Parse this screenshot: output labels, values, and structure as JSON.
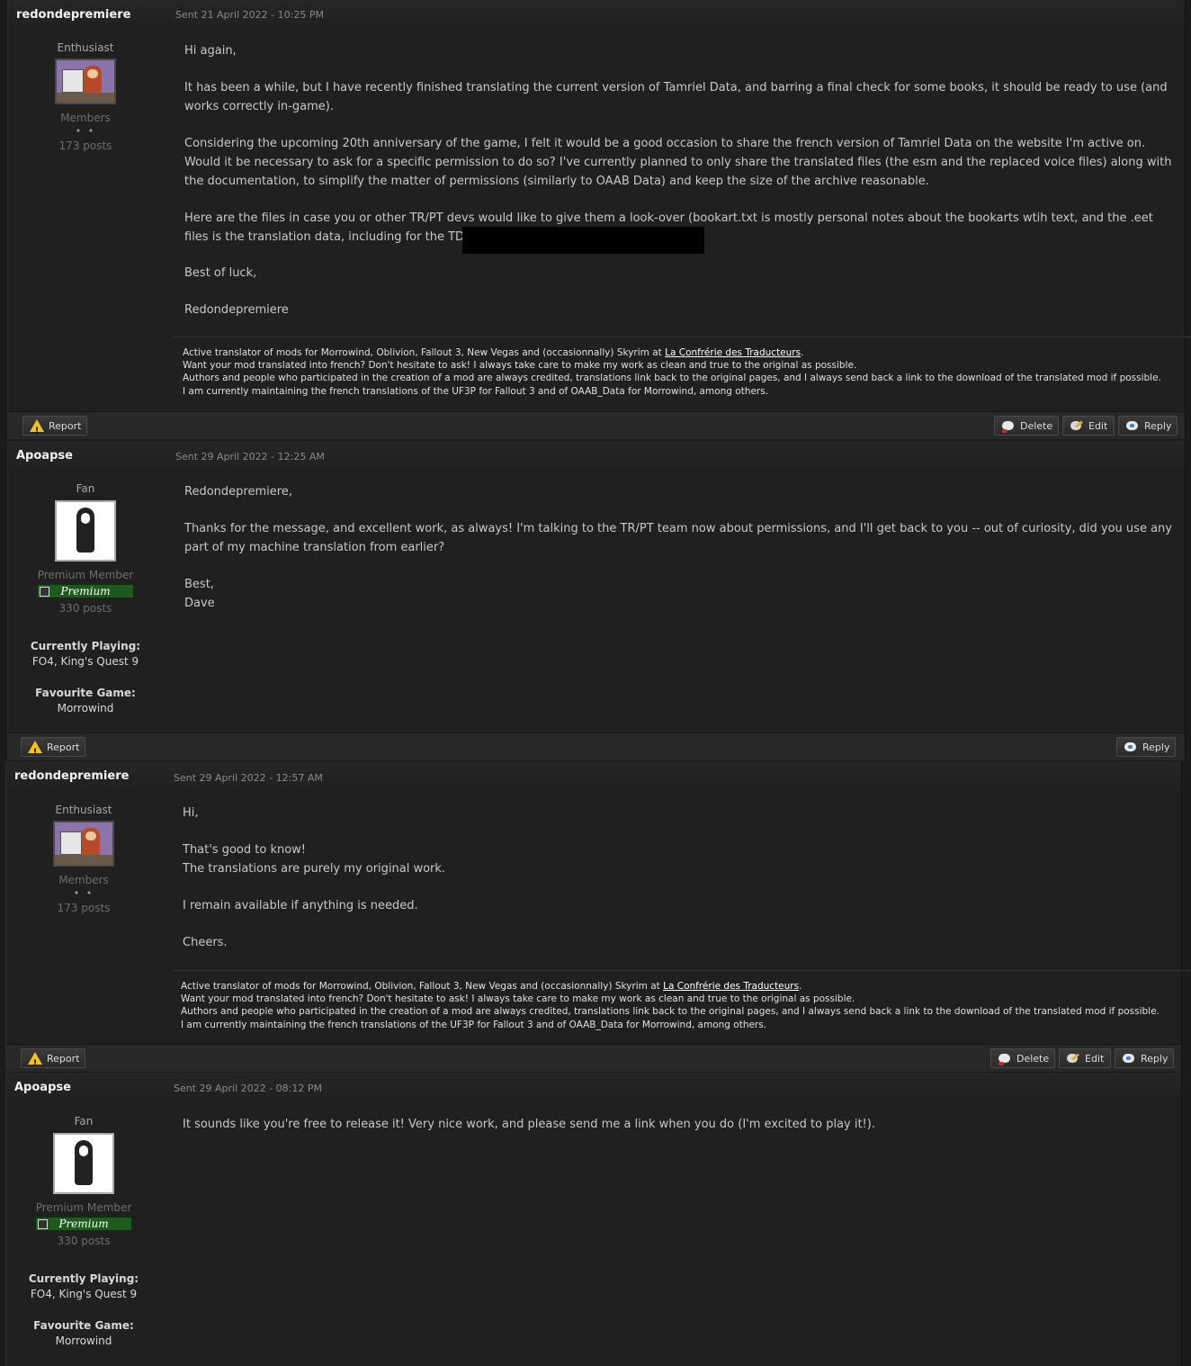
{
  "posts": [
    {
      "author": "redondepremiere",
      "date": "Sent 21 April 2022 - 10:25 PM",
      "rank": "Enthusiast",
      "group": "Members",
      "pips": "• •",
      "post_count": "173 posts",
      "paragraphs": [
        "Hi again,",
        "It has been a while, but I have recently finished translating the current version of Tamriel Data, and barring a final check for some books, it should be ready to use (and works correctly in-game).",
        "Considering the upcoming 20th anniversary of the game, I felt it would be a good occasion to share the french version of Tamriel Data on the website I'm active on.\nWould it be necessary to ask for a specific permission to do so? I've currently planned to only share the translated files (the esm and the replaced voice files) along with the documentation, to simplify the matter of permissions (similarly to OAAB Data) and keep the size of the archive reasonable.",
        "Here are the files in case you or other TR/PT devs would like to give them a look-over (bookart.txt is mostly personal notes about the bookarts wtih text, and the .eet files is the translation data, including for the TD addon):",
        "Best of luck,",
        "Redondepremiere"
      ],
      "buttons": [
        "Report",
        "Delete",
        "Edit",
        "Reply"
      ]
    },
    {
      "author": "Apoapse",
      "date": "Sent 29 April 2022 - 12:25 AM",
      "rank": "Fan",
      "group": "Premium Member",
      "badge": "Premium",
      "post_count": "330 posts",
      "cf1_label": "Currently Playing:",
      "cf1_value": "FO4, King's Quest 9",
      "cf2_label": "Favourite Game:",
      "cf2_value": "Morrowind",
      "paragraphs": [
        "Redondepremiere,",
        "Thanks for the message, and excellent work, as always! I'm talking to the TR/PT team now about permissions, and I'll get back to you -- out of curiosity, did you use any part of my machine translation from earlier?",
        "Best,\nDave"
      ],
      "buttons": [
        "Report",
        "Reply"
      ]
    },
    {
      "author": "redondepremiere",
      "date": "Sent 29 April 2022 - 12:57 AM",
      "rank": "Enthusiast",
      "group": "Members",
      "pips": "• •",
      "post_count": "173 posts",
      "paragraphs": [
        "Hi,",
        "That's good to know!\nThe translations are purely my original work.",
        "I remain available if anything is needed.",
        "Cheers."
      ],
      "buttons": [
        "Report",
        "Delete",
        "Edit",
        "Reply"
      ]
    },
    {
      "author": "Apoapse",
      "date": "Sent 29 April 2022 - 08:12 PM",
      "rank": "Fan",
      "group": "Premium Member",
      "badge": "Premium",
      "post_count": "330 posts",
      "cf1_label": "Currently Playing:",
      "cf1_value": "FO4, King's Quest 9",
      "cf2_label": "Favourite Game:",
      "cf2_value": "Morrowind",
      "paragraphs": [
        "It sounds like you're free to release it! Very nice work, and please send me a link when you do (I'm excited to play it!)."
      ]
    }
  ],
  "signature": {
    "line1_prefix": "Active translator of mods for Morrowind, Oblivion, Fallout 3, New Vegas and (occasionnally) Skyrim  at ",
    "line1_link": "La Confrérie des Traducteurs",
    "line1_suffix": ".",
    "line2": "Want your mod translated into french? Don't hesitate to ask! I always take care to make my work as clean and true to the original as possible.",
    "line3": "Authors and people who participated in the creation of a mod are always credited, translations link back to the original pages, and I always send back a link to the download of the translated mod if possible.",
    "line4": "I am currently maintaining the french translations of the UF3P for Fallout 3 and of OAAB_Data for Morrowind, among others."
  },
  "colors": {
    "page_bg": "#1b1b1b",
    "post_bg": "#202020",
    "premium_badge": "#1e5a1e",
    "warning": "#f0c020"
  },
  "icons": [
    "warning-icon",
    "delete-bubble-icon",
    "edit-pencil-icon",
    "reply-bubble-icon"
  ]
}
